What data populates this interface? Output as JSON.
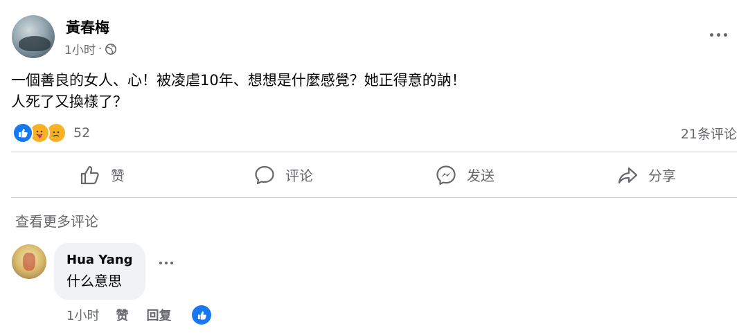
{
  "post": {
    "author": "黃春梅",
    "time": "1小时",
    "separator": "·",
    "text": "一個善良的女人、心！被凌虐10年、想想是什麼感覺？她正得意的訥！\n人死了又換樣了？",
    "reaction_count": "52",
    "comment_count": "21条评论"
  },
  "actions": {
    "like": "赞",
    "comment": "评论",
    "send": "发送",
    "share": "分享"
  },
  "comments": {
    "view_more": "查看更多评论",
    "items": [
      {
        "author": "Hua Yang",
        "text": "什么意思",
        "time": "1小时",
        "like_label": "赞",
        "reply_label": "回复"
      }
    ]
  },
  "icons": {
    "privacy": "globe-icon",
    "more": "more-horizontal-icon",
    "like": "thumbs-up-icon",
    "comment": "comment-bubble-icon",
    "send": "messenger-icon",
    "share": "share-arrow-icon"
  },
  "colors": {
    "accent": "#1877f2",
    "secondary_text": "#65676b",
    "bubble": "#f0f2f5",
    "divider": "#ced0d4"
  }
}
